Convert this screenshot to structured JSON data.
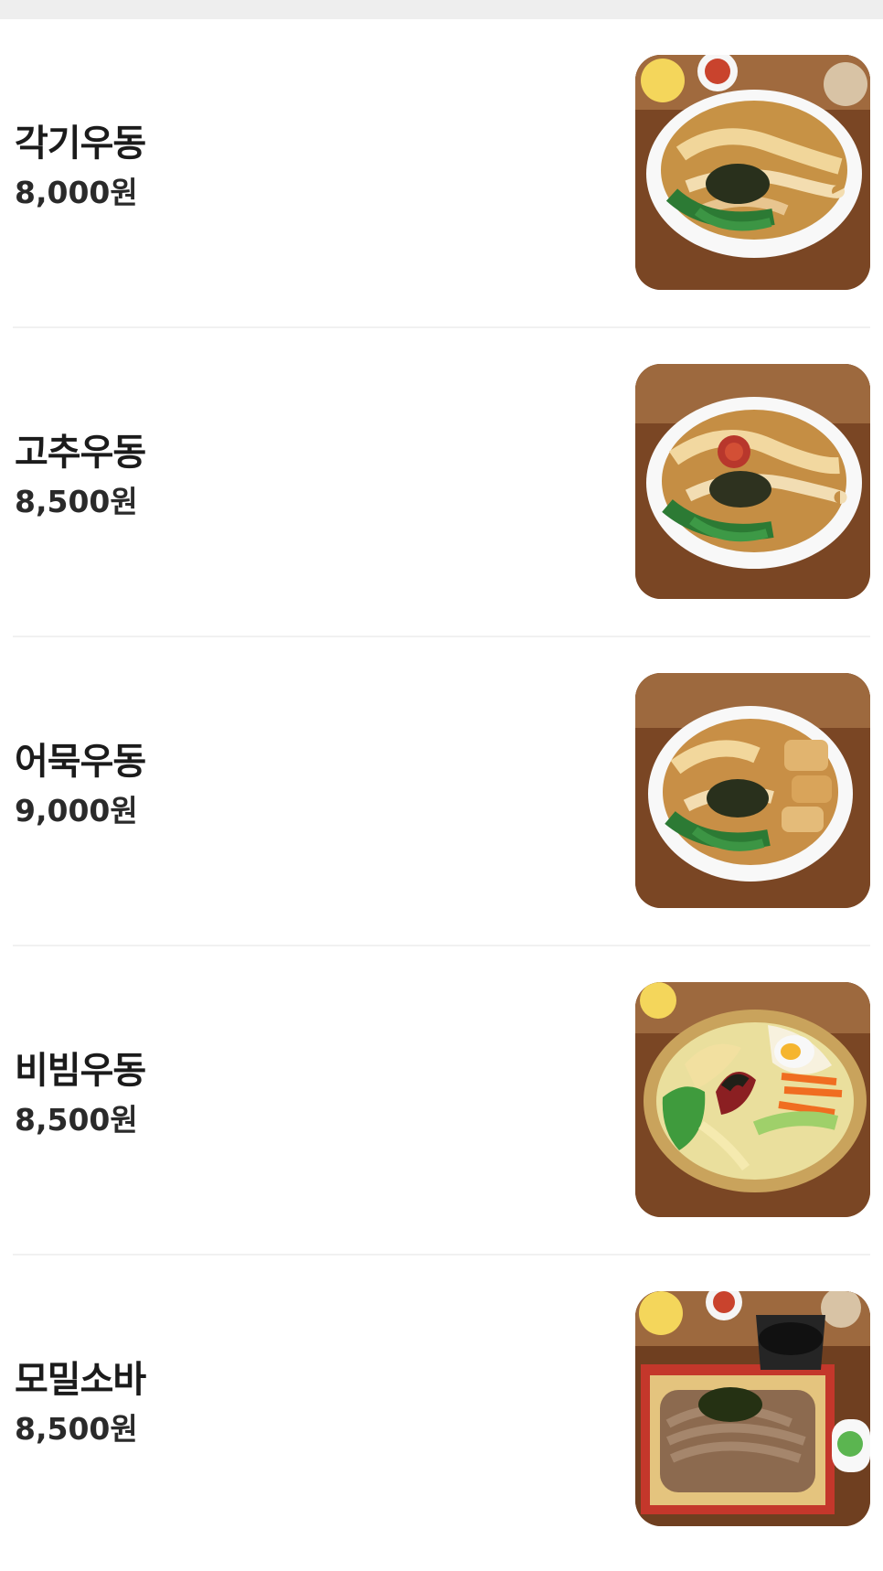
{
  "menu": {
    "items": [
      {
        "name": "각기우동",
        "price": "8,000원",
        "photo_icon": "udon-bowl-icon"
      },
      {
        "name": "고추우동",
        "price": "8,500원",
        "photo_icon": "spicy-udon-bowl-icon"
      },
      {
        "name": "어묵우동",
        "price": "9,000원",
        "photo_icon": "fishcake-udon-bowl-icon"
      },
      {
        "name": "비빔우동",
        "price": "8,500원",
        "photo_icon": "bibim-udon-bowl-icon"
      },
      {
        "name": "모밀소바",
        "price": "8,500원",
        "photo_icon": "soba-tray-icon"
      }
    ]
  },
  "colors": {
    "background": "#ffffff",
    "divider": "#f1f1f1",
    "top_strip": "#eeeeee",
    "text": "#1b1b1b"
  }
}
